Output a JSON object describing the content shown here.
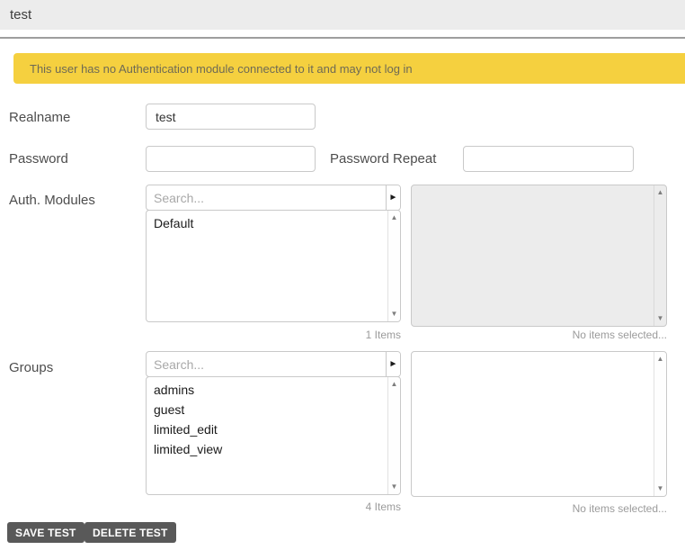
{
  "header": {
    "title": "test"
  },
  "warning": {
    "text": "This user has no Authentication module connected to it and may not log in",
    "bg": "#f5d03f"
  },
  "fields": {
    "realname": {
      "label": "Realname",
      "value": "test"
    },
    "password": {
      "label": "Password",
      "value": ""
    },
    "password_repeat": {
      "label": "Password Repeat",
      "value": ""
    },
    "auth_modules": {
      "label": "Auth. Modules",
      "search_placeholder": "Search...",
      "available_items": [
        "Default"
      ],
      "selected_items": [],
      "count_text": "1 Items",
      "selected_text": "No items selected..."
    },
    "groups": {
      "label": "Groups",
      "search_placeholder": "Search...",
      "available_items": [
        "admins",
        "guest",
        "limited_edit",
        "limited_view"
      ],
      "selected_items": [],
      "count_text": "4 Items",
      "selected_text": "No items selected..."
    }
  },
  "buttons": {
    "save": "SAVE TEST",
    "delete": "DELETE TEST"
  },
  "icons": {
    "picker_arrow": "►",
    "scroll_up": "▲",
    "scroll_down": "▼"
  }
}
